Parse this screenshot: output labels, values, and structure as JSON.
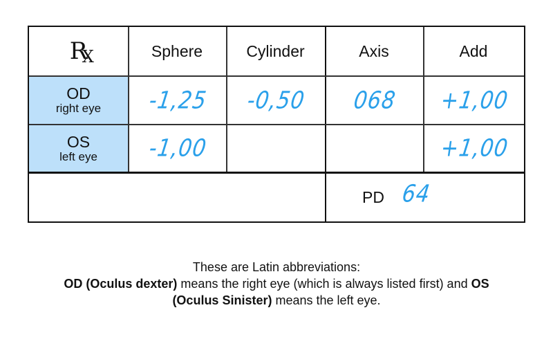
{
  "prescription": {
    "rx_symbol": "R",
    "rx_symbol_sub": "X",
    "columns": [
      "Sphere",
      "Cylinder",
      "Axis",
      "Add"
    ],
    "rows": [
      {
        "code": "OD",
        "label": "right eye",
        "sphere": "-1,25",
        "cylinder": "-0,50",
        "axis": "068",
        "add": "+1,00"
      },
      {
        "code": "OS",
        "label": "left eye",
        "sphere": "-1,00",
        "cylinder": "",
        "axis": "",
        "add": "+1,00"
      }
    ],
    "pd_label": "PD",
    "pd_value": "64",
    "colors": {
      "eye_cell_bg": "#bde0fa",
      "handwriting": "#2aa0ea",
      "border": "#111111"
    }
  },
  "note": {
    "line1": "These are Latin abbreviations:",
    "od_bold": "OD (Oculus dexter)",
    "od_text": " means the right eye (which is always listed first) and ",
    "os_bold": "OS",
    "os_bold2": "(Oculus Sinister)",
    "os_text": " means the left eye."
  }
}
